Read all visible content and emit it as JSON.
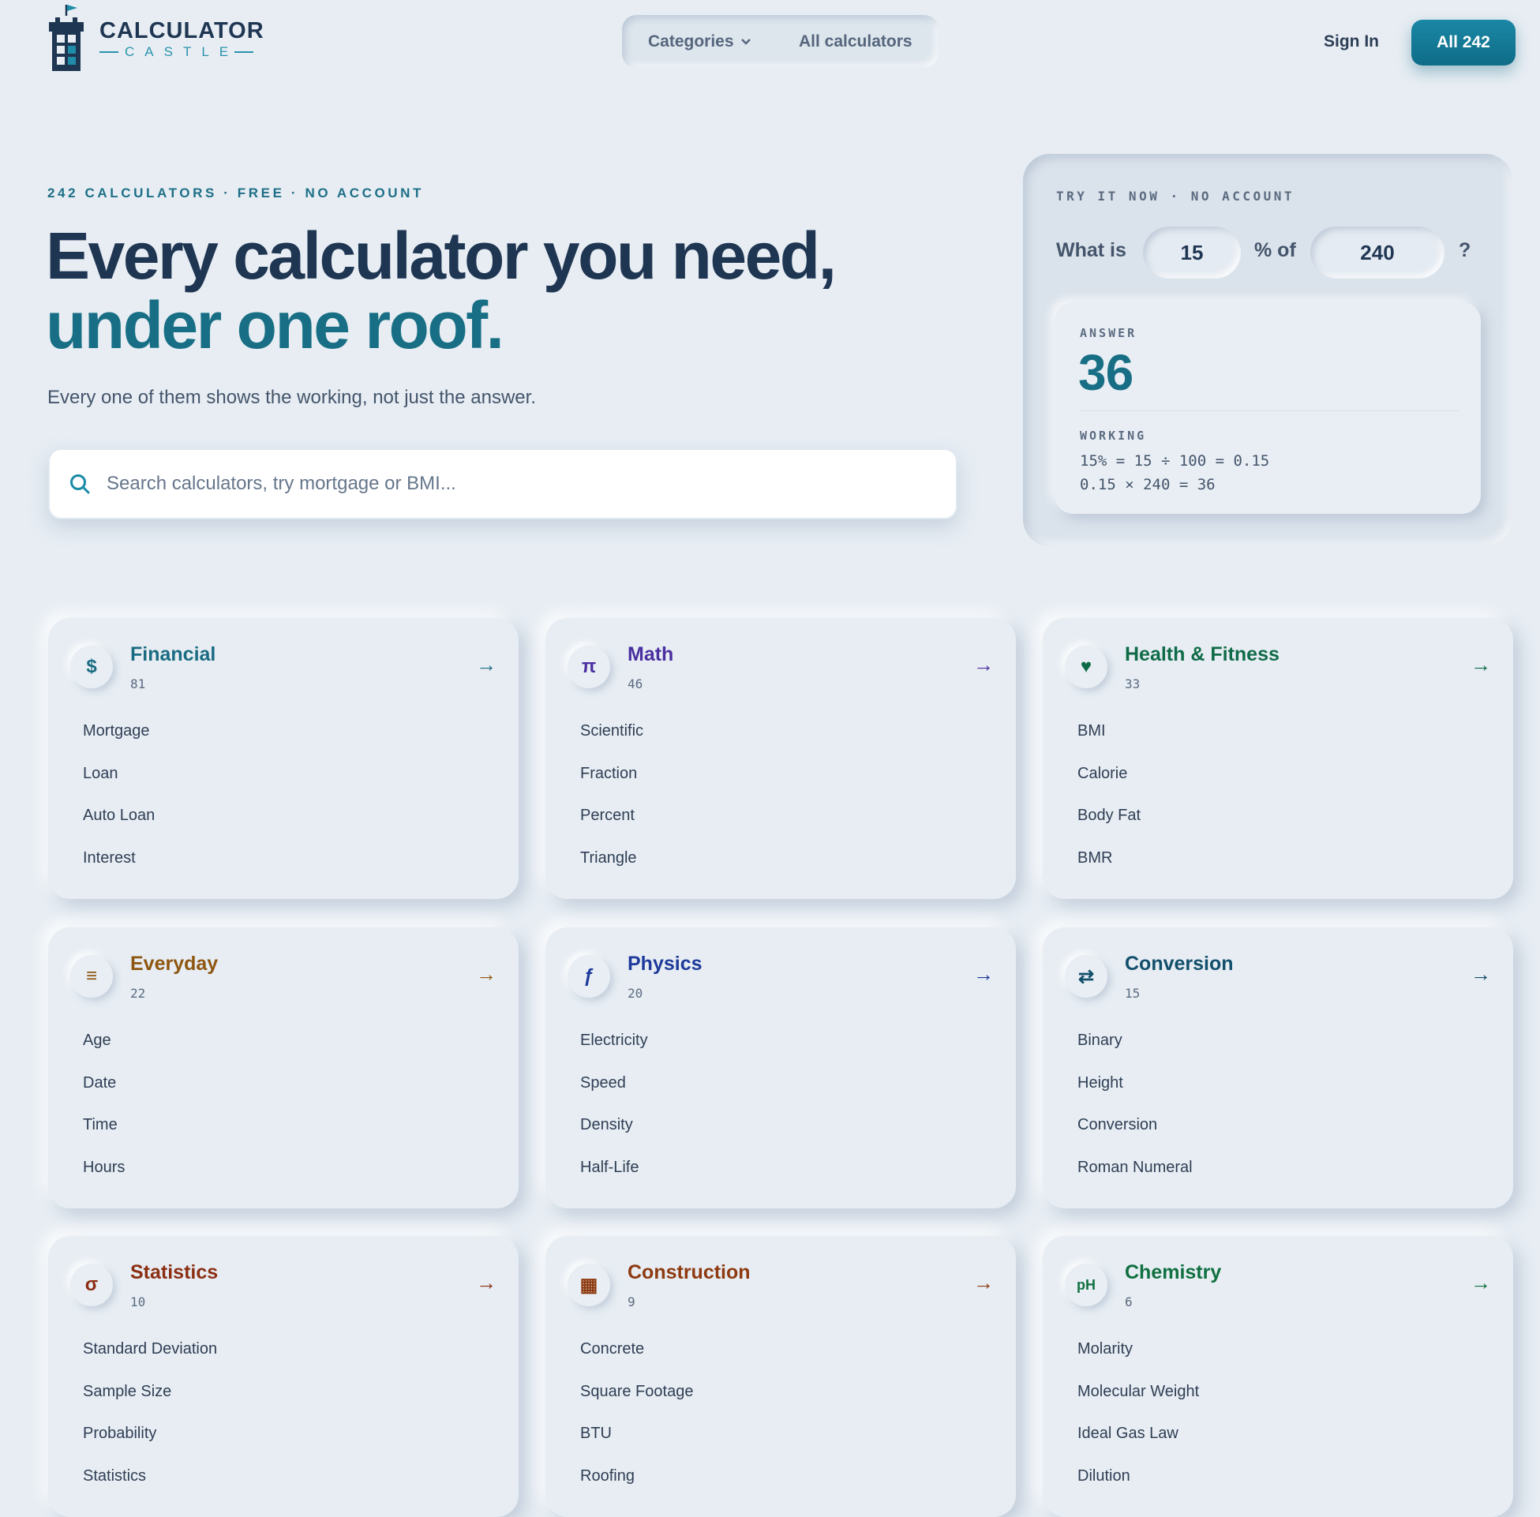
{
  "header": {
    "logo_main": "CALCULATOR",
    "logo_sub": "CASTLE",
    "nav": {
      "categories": "Categories",
      "all_calculators": "All calculators"
    },
    "signin": "Sign In",
    "all_button": "All 242"
  },
  "hero": {
    "eyebrow": "242 CALCULATORS · FREE · NO ACCOUNT",
    "title_line1": "Every calculator you need,",
    "title_line2": "under one roof.",
    "lead": "Every one of them shows the working, not just the answer.",
    "search_placeholder": "Search calculators, try mortgage or BMI..."
  },
  "try_it": {
    "eyebrow": "TRY IT NOW · NO ACCOUNT",
    "q_prefix": "What is",
    "value1": "15",
    "q_mid": "% of",
    "value2": "240",
    "q_end": "?",
    "answer_label": "ANSWER",
    "answer": "36",
    "working_label": "WORKING",
    "working_line1": "15% = 15 ÷ 100 = 0.15",
    "working_line2": "0.15 × 240 = 36"
  },
  "categories": [
    {
      "title": "Financial",
      "count": "81",
      "icon": "dollar-icon",
      "glyph": "$",
      "color": "#196b82",
      "links": [
        "Mortgage",
        "Loan",
        "Auto Loan",
        "Interest"
      ]
    },
    {
      "title": "Math",
      "count": "46",
      "icon": "pi-icon",
      "glyph": "π",
      "color": "#4a2fa0",
      "links": [
        "Scientific",
        "Fraction",
        "Percent",
        "Triangle"
      ]
    },
    {
      "title": "Health & Fitness",
      "count": "33",
      "icon": "heart-icon",
      "glyph": "♥",
      "color": "#0f6b47",
      "links": [
        "BMI",
        "Calorie",
        "Body Fat",
        "BMR"
      ]
    },
    {
      "title": "Everyday",
      "count": "22",
      "icon": "list-icon",
      "glyph": "≡",
      "color": "#8e5610",
      "links": [
        "Age",
        "Date",
        "Time",
        "Hours"
      ]
    },
    {
      "title": "Physics",
      "count": "20",
      "icon": "function-icon",
      "glyph": "ƒ",
      "color": "#1e3a9a",
      "links": [
        "Electricity",
        "Speed",
        "Density",
        "Half-Life"
      ]
    },
    {
      "title": "Conversion",
      "count": "15",
      "icon": "swap-icon",
      "glyph": "⇄",
      "color": "#124f6b",
      "links": [
        "Binary",
        "Height",
        "Conversion",
        "Roman Numeral"
      ]
    },
    {
      "title": "Statistics",
      "count": "10",
      "icon": "sigma-icon",
      "glyph": "σ",
      "color": "#8b2e12",
      "links": [
        "Standard Deviation",
        "Sample Size",
        "Probability",
        "Statistics"
      ]
    },
    {
      "title": "Construction",
      "count": "9",
      "icon": "brick-icon",
      "glyph": "▦",
      "color": "#8e3a10",
      "links": [
        "Concrete",
        "Square Footage",
        "BTU",
        "Roofing"
      ]
    },
    {
      "title": "Chemistry",
      "count": "6",
      "icon": "ph-icon",
      "glyph": "pH",
      "color": "#0f7040",
      "links": [
        "Molarity",
        "Molecular Weight",
        "Ideal Gas Law",
        "Dilution"
      ]
    }
  ],
  "arrow_glyph": "→"
}
